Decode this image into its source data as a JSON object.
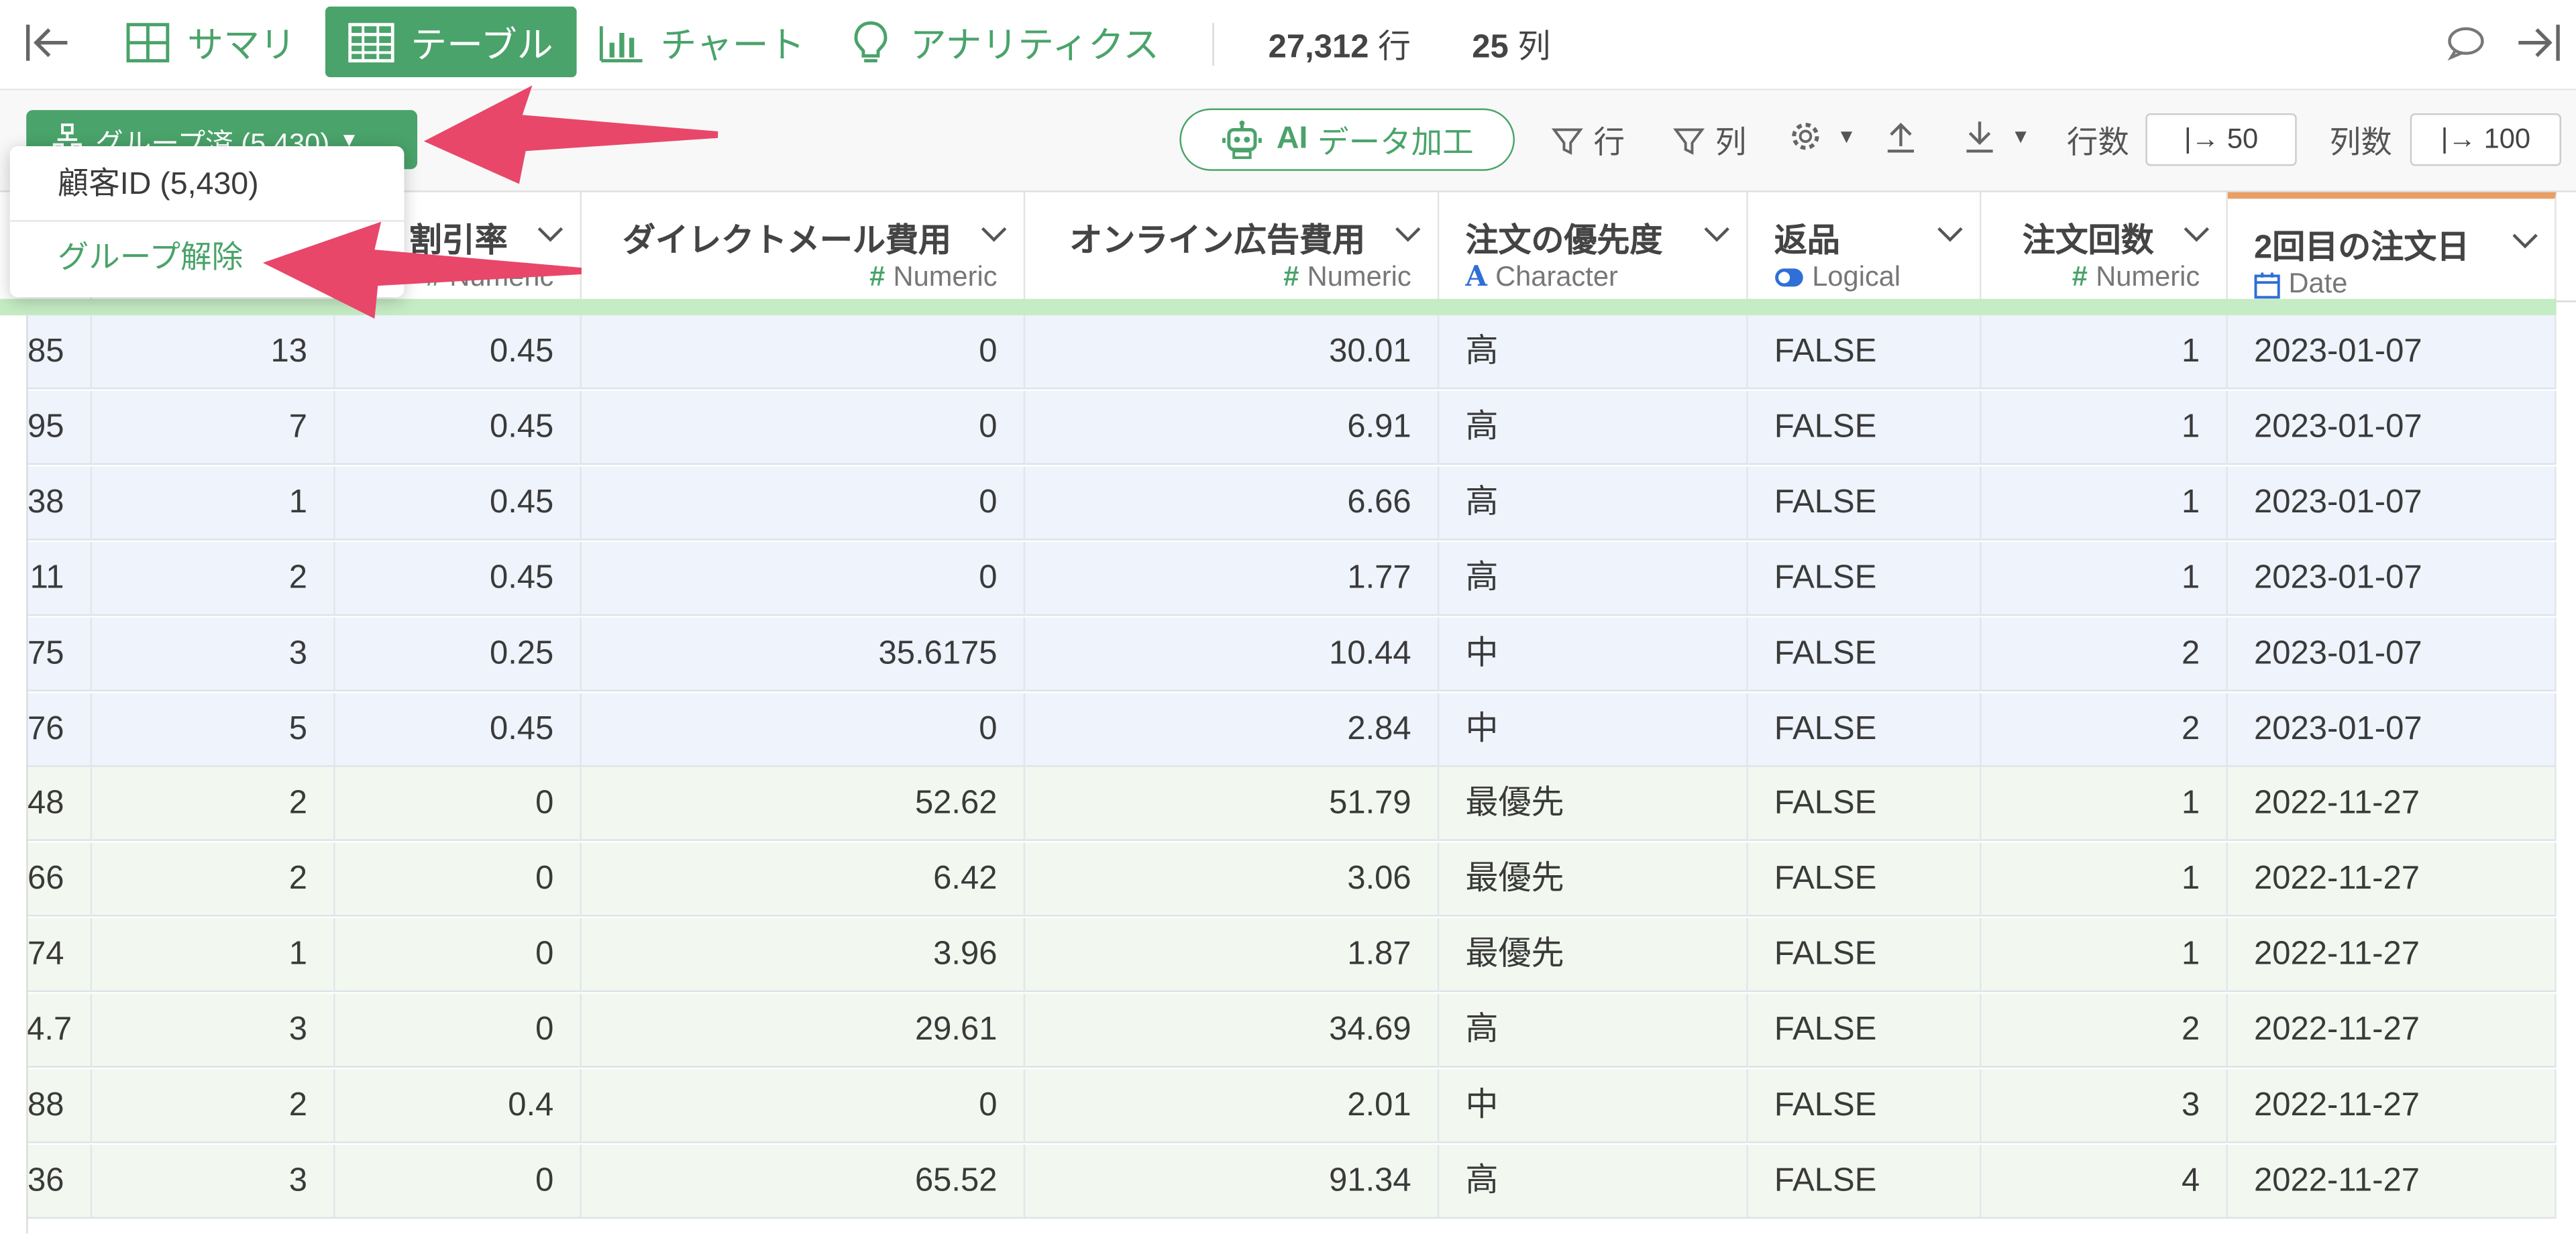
{
  "topbar": {
    "tabs": [
      {
        "label": "サマリ",
        "icon": "grid-icon"
      },
      {
        "label": "テーブル",
        "icon": "table-icon",
        "active": true
      },
      {
        "label": "チャート",
        "icon": "bar-chart-icon"
      },
      {
        "label": "アナリティクス",
        "icon": "lightbulb-icon"
      }
    ],
    "rows_count": "27,312",
    "rows_unit": "行",
    "cols_count": "25",
    "cols_unit": "列"
  },
  "toolbar": {
    "group_button_label": "グループ済 (5,430)",
    "ai_label_bold": "AI",
    "ai_label": "データ加工",
    "filter_rows_label": "行",
    "filter_cols_label": "列",
    "row_count_label": "行数",
    "row_count_value": "|→ 50",
    "col_count_label": "列数",
    "col_count_value": "|→ 100"
  },
  "dropdown": {
    "item1": "顧客ID (5,430)",
    "item2": "グループ解除"
  },
  "columns": [
    {
      "name": "",
      "type": "",
      "type_icon": ""
    },
    {
      "name": "",
      "type": "",
      "type_icon": ""
    },
    {
      "name": "割引率",
      "type": "Numeric",
      "type_icon": "#"
    },
    {
      "name": "ダイレクトメール費用",
      "type": "Numeric",
      "type_icon": "#"
    },
    {
      "name": "オンライン広告費用",
      "type": "Numeric",
      "type_icon": "#"
    },
    {
      "name": "注文の優先度",
      "type": "Character",
      "type_icon": "A"
    },
    {
      "name": "返品",
      "type": "Logical",
      "type_icon": "toggle"
    },
    {
      "name": "注文回数",
      "type": "Numeric",
      "type_icon": "#"
    },
    {
      "name": "2回目の注文日",
      "type": "Date",
      "type_icon": "calendar"
    }
  ],
  "rows": [
    {
      "group": "blue",
      "cells": [
        "85",
        "13",
        "0.45",
        "0",
        "30.01",
        "高",
        "FALSE",
        "1",
        "2023-01-07"
      ]
    },
    {
      "group": "blue",
      "cells": [
        "95",
        "7",
        "0.45",
        "0",
        "6.91",
        "高",
        "FALSE",
        "1",
        "2023-01-07"
      ]
    },
    {
      "group": "blue",
      "cells": [
        "38",
        "1",
        "0.45",
        "0",
        "6.66",
        "高",
        "FALSE",
        "1",
        "2023-01-07"
      ]
    },
    {
      "group": "blue",
      "cells": [
        "11",
        "2",
        "0.45",
        "0",
        "1.77",
        "高",
        "FALSE",
        "1",
        "2023-01-07"
      ]
    },
    {
      "group": "blue",
      "cells": [
        "75",
        "3",
        "0.25",
        "35.6175",
        "10.44",
        "中",
        "FALSE",
        "2",
        "2023-01-07"
      ]
    },
    {
      "group": "blue",
      "cells": [
        "76",
        "5",
        "0.45",
        "0",
        "2.84",
        "中",
        "FALSE",
        "2",
        "2023-01-07"
      ]
    },
    {
      "group": "green",
      "cells": [
        "48",
        "2",
        "0",
        "52.62",
        "51.79",
        "最優先",
        "FALSE",
        "1",
        "2022-11-27"
      ]
    },
    {
      "group": "green",
      "cells": [
        "66",
        "2",
        "0",
        "6.42",
        "3.06",
        "最優先",
        "FALSE",
        "1",
        "2022-11-27"
      ]
    },
    {
      "group": "green",
      "cells": [
        "74",
        "1",
        "0",
        "3.96",
        "1.87",
        "最優先",
        "FALSE",
        "1",
        "2022-11-27"
      ]
    },
    {
      "group": "green",
      "cells": [
        "4.7",
        "3",
        "0",
        "29.61",
        "34.69",
        "高",
        "FALSE",
        "2",
        "2022-11-27"
      ]
    },
    {
      "group": "green",
      "cells": [
        "88",
        "2",
        "0.4",
        "0",
        "2.01",
        "中",
        "FALSE",
        "3",
        "2022-11-27"
      ]
    },
    {
      "group": "green",
      "cells": [
        "36",
        "3",
        "0",
        "65.52",
        "91.34",
        "高",
        "FALSE",
        "4",
        "2022-11-27"
      ]
    }
  ],
  "colors": {
    "accent": "#4aa36a",
    "annotation_arrow": "#e8476a",
    "group_blue": "#eef3fc",
    "group_green": "#f2f8ef"
  }
}
